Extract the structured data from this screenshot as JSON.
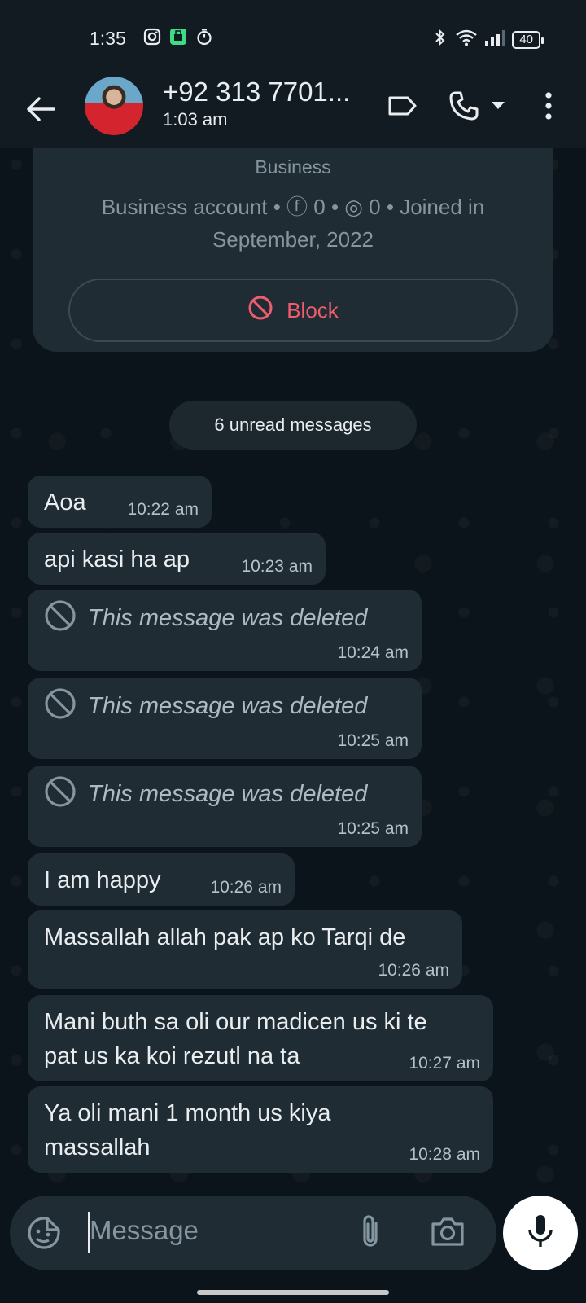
{
  "status_bar": {
    "time": "1:35",
    "battery": "40",
    "left_icons": [
      "instagram-icon",
      "store-icon",
      "timer-icon"
    ],
    "right_icons": [
      "bluetooth-icon",
      "wifi-icon",
      "signal-icon",
      "battery-icon"
    ]
  },
  "header": {
    "contact_name": "+92 313 7701...",
    "last_seen": "1:03 am"
  },
  "info_card": {
    "category": "Business",
    "meta_line": "Business account • ⓕ 0 • ◎ 0 • Joined in September, 2022",
    "block_label": "Block"
  },
  "unread_label": "6 unread messages",
  "messages": [
    {
      "text": "Aoa",
      "time": "10:22 am",
      "deleted": false
    },
    {
      "text": "api kasi ha ap",
      "time": "10:23 am",
      "deleted": false
    },
    {
      "text": "This message was deleted",
      "time": "10:24 am",
      "deleted": true
    },
    {
      "text": "This message was deleted",
      "time": "10:25 am",
      "deleted": true
    },
    {
      "text": "This message was deleted",
      "time": "10:25 am",
      "deleted": true
    },
    {
      "text": "I am happy",
      "time": "10:26 am",
      "deleted": false
    },
    {
      "text": "Massallah allah pak ap ko Tarqi de",
      "time": "10:26 am",
      "deleted": false
    },
    {
      "text": "Mani buth sa oli our madicen us ki te pat us ka koi rezutl na ta",
      "time": "10:27 am",
      "deleted": false
    },
    {
      "text": "Ya oli mani 1 month us kiya massallah",
      "time": "10:28 am",
      "deleted": false
    }
  ],
  "composer": {
    "placeholder": "Message"
  },
  "colors": {
    "background": "#0b141a",
    "bubble": "#1f2c34",
    "block_red": "#f15c6d",
    "muted_text": "#8696a0"
  }
}
